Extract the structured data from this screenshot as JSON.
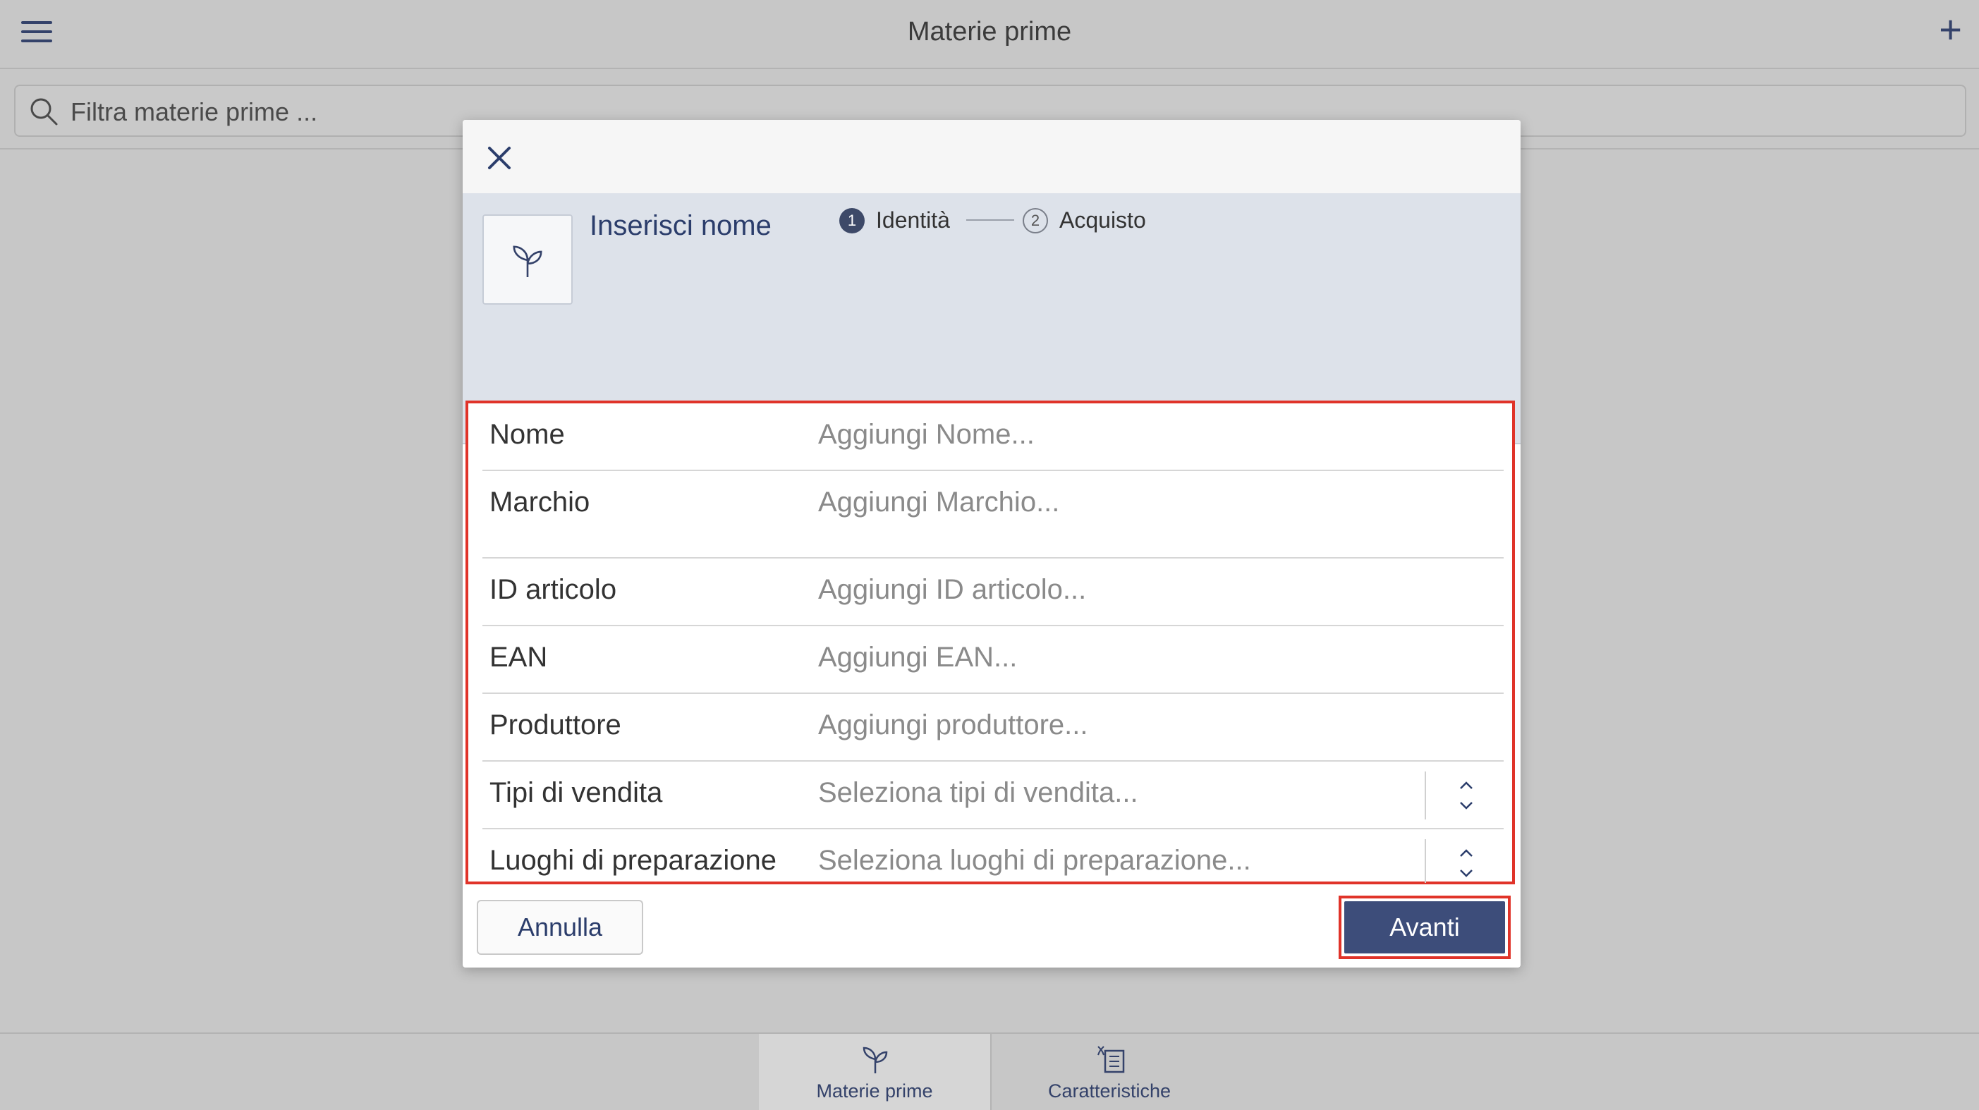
{
  "app": {
    "title": "Materie prime",
    "search_placeholder": "Filtra materie prime ..."
  },
  "bottom_tabs": [
    {
      "label": "Materie prime",
      "icon": "sprout-icon",
      "active": true
    },
    {
      "label": "Caratteristiche",
      "icon": "list-icon",
      "active": false
    }
  ],
  "modal": {
    "title": "Inserisci nome",
    "steps": [
      {
        "num": "1",
        "label": "Identità",
        "active": true
      },
      {
        "num": "2",
        "label": "Acquisto",
        "active": false
      }
    ],
    "fields": [
      {
        "label": "Nome",
        "placeholder": "Aggiungi Nome..."
      },
      {
        "label": "Marchio",
        "placeholder": "Aggiungi Marchio..."
      },
      {
        "label": "ID articolo",
        "placeholder": "Aggiungi ID articolo..."
      },
      {
        "label": "EAN",
        "placeholder": "Aggiungi EAN..."
      },
      {
        "label": "Produttore",
        "placeholder": "Aggiungi produttore..."
      },
      {
        "label": "Tipi di vendita",
        "placeholder": "Seleziona tipi di vendita..."
      },
      {
        "label": "Luoghi di preparazione",
        "placeholder": "Seleziona luoghi di preparazione..."
      }
    ],
    "cancel_label": "Annulla",
    "next_label": "Avanti"
  },
  "colors": {
    "accent": "#3d4d7a",
    "highlight": "#e03329",
    "header_bg": "#dde2ea",
    "backdrop": "#c7c7c7"
  }
}
